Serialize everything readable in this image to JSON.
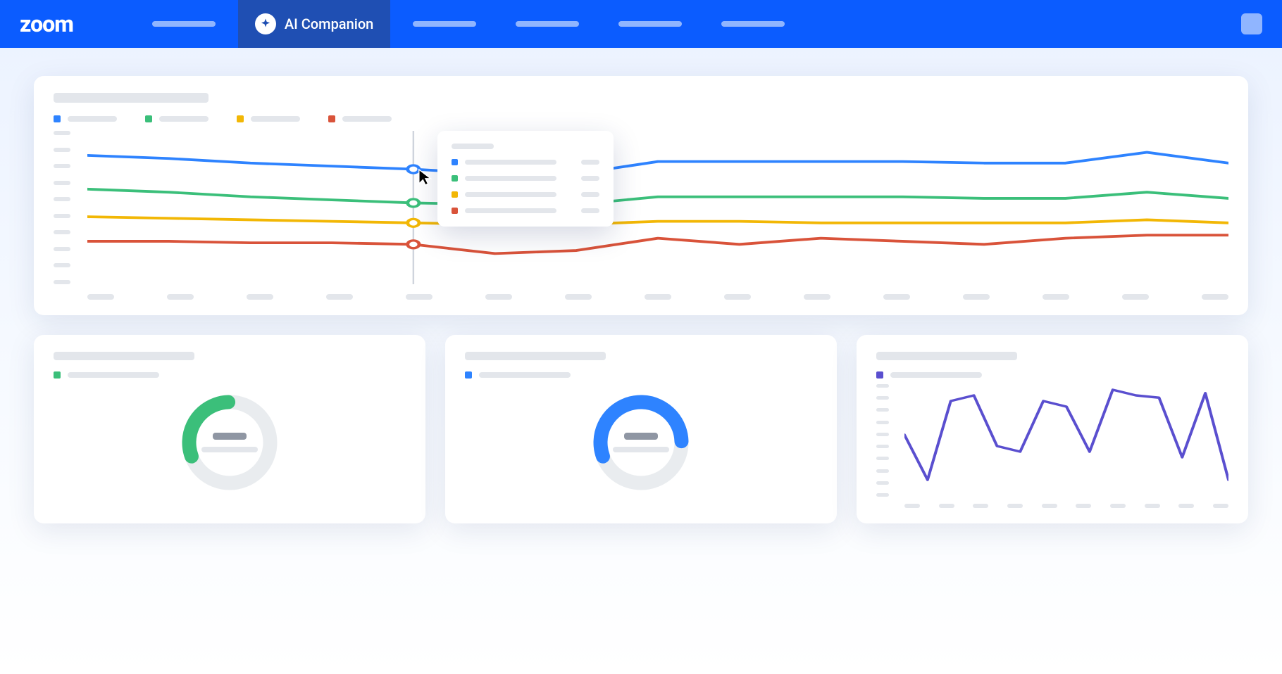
{
  "brand": "zoom",
  "nav": {
    "active_label": "AI Companion",
    "placeholder_items": 5
  },
  "colors": {
    "blue": "#2e83ff",
    "green": "#3bbf7a",
    "yellow": "#f2b705",
    "red": "#d9533a",
    "purple": "#5a4fcf",
    "grey_ring": "#e9ecef"
  },
  "chart_data": [
    {
      "id": "main_line",
      "type": "line",
      "x_count": 15,
      "hover_index": 4,
      "y_ticks": 10,
      "series": [
        {
          "name": "blue",
          "color": "#2e83ff",
          "values": [
            84,
            82,
            79,
            77,
            75,
            72,
            72,
            80,
            80,
            80,
            80,
            79,
            79,
            86,
            79
          ]
        },
        {
          "name": "green",
          "color": "#3bbf7a",
          "values": [
            62,
            60,
            57,
            55,
            53,
            52,
            52,
            57,
            57,
            57,
            57,
            56,
            56,
            60,
            56
          ]
        },
        {
          "name": "yellow",
          "color": "#f2b705",
          "values": [
            44,
            43,
            42,
            41,
            40,
            39,
            39,
            41,
            41,
            40,
            40,
            40,
            40,
            42,
            40
          ]
        },
        {
          "name": "red",
          "color": "#d9533a",
          "values": [
            28,
            28,
            27,
            27,
            26,
            20,
            22,
            30,
            26,
            30,
            28,
            26,
            30,
            32,
            32
          ]
        }
      ]
    },
    {
      "id": "donut_green",
      "type": "pie",
      "ring_color": "#3bbf7a",
      "percent": 30
    },
    {
      "id": "donut_blue",
      "type": "pie",
      "ring_color": "#2e83ff",
      "percent": 55
    },
    {
      "id": "mini_line",
      "type": "line",
      "color": "#5a4fcf",
      "y_ticks": 10,
      "x_count": 10,
      "values": [
        55,
        15,
        85,
        90,
        45,
        40,
        85,
        80,
        40,
        95,
        90,
        88,
        35,
        92,
        15
      ]
    }
  ]
}
